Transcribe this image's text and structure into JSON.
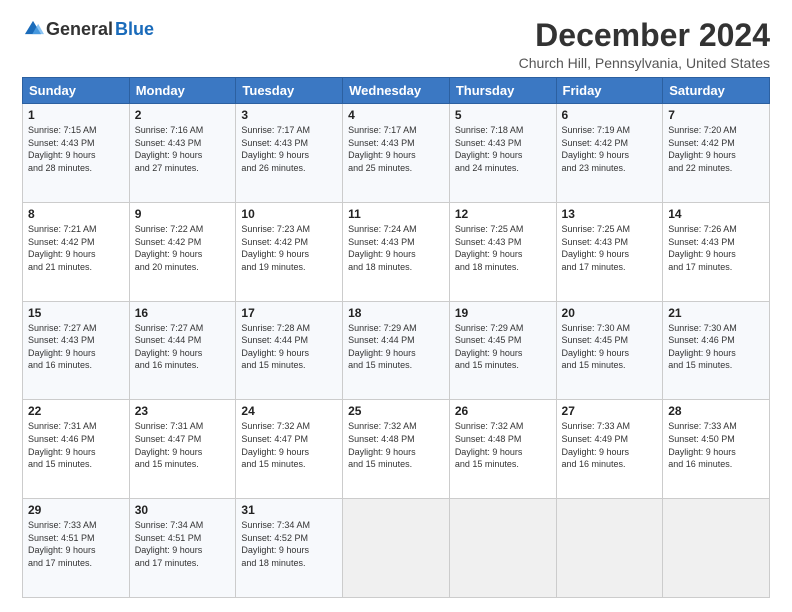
{
  "logo": {
    "general": "General",
    "blue": "Blue"
  },
  "title": "December 2024",
  "subtitle": "Church Hill, Pennsylvania, United States",
  "header_days": [
    "Sunday",
    "Monday",
    "Tuesday",
    "Wednesday",
    "Thursday",
    "Friday",
    "Saturday"
  ],
  "weeks": [
    [
      {
        "day": "1",
        "info": "Sunrise: 7:15 AM\nSunset: 4:43 PM\nDaylight: 9 hours\nand 28 minutes."
      },
      {
        "day": "2",
        "info": "Sunrise: 7:16 AM\nSunset: 4:43 PM\nDaylight: 9 hours\nand 27 minutes."
      },
      {
        "day": "3",
        "info": "Sunrise: 7:17 AM\nSunset: 4:43 PM\nDaylight: 9 hours\nand 26 minutes."
      },
      {
        "day": "4",
        "info": "Sunrise: 7:17 AM\nSunset: 4:43 PM\nDaylight: 9 hours\nand 25 minutes."
      },
      {
        "day": "5",
        "info": "Sunrise: 7:18 AM\nSunset: 4:43 PM\nDaylight: 9 hours\nand 24 minutes."
      },
      {
        "day": "6",
        "info": "Sunrise: 7:19 AM\nSunset: 4:42 PM\nDaylight: 9 hours\nand 23 minutes."
      },
      {
        "day": "7",
        "info": "Sunrise: 7:20 AM\nSunset: 4:42 PM\nDaylight: 9 hours\nand 22 minutes."
      }
    ],
    [
      {
        "day": "8",
        "info": "Sunrise: 7:21 AM\nSunset: 4:42 PM\nDaylight: 9 hours\nand 21 minutes."
      },
      {
        "day": "9",
        "info": "Sunrise: 7:22 AM\nSunset: 4:42 PM\nDaylight: 9 hours\nand 20 minutes."
      },
      {
        "day": "10",
        "info": "Sunrise: 7:23 AM\nSunset: 4:42 PM\nDaylight: 9 hours\nand 19 minutes."
      },
      {
        "day": "11",
        "info": "Sunrise: 7:24 AM\nSunset: 4:43 PM\nDaylight: 9 hours\nand 18 minutes."
      },
      {
        "day": "12",
        "info": "Sunrise: 7:25 AM\nSunset: 4:43 PM\nDaylight: 9 hours\nand 18 minutes."
      },
      {
        "day": "13",
        "info": "Sunrise: 7:25 AM\nSunset: 4:43 PM\nDaylight: 9 hours\nand 17 minutes."
      },
      {
        "day": "14",
        "info": "Sunrise: 7:26 AM\nSunset: 4:43 PM\nDaylight: 9 hours\nand 17 minutes."
      }
    ],
    [
      {
        "day": "15",
        "info": "Sunrise: 7:27 AM\nSunset: 4:43 PM\nDaylight: 9 hours\nand 16 minutes."
      },
      {
        "day": "16",
        "info": "Sunrise: 7:27 AM\nSunset: 4:44 PM\nDaylight: 9 hours\nand 16 minutes."
      },
      {
        "day": "17",
        "info": "Sunrise: 7:28 AM\nSunset: 4:44 PM\nDaylight: 9 hours\nand 15 minutes."
      },
      {
        "day": "18",
        "info": "Sunrise: 7:29 AM\nSunset: 4:44 PM\nDaylight: 9 hours\nand 15 minutes."
      },
      {
        "day": "19",
        "info": "Sunrise: 7:29 AM\nSunset: 4:45 PM\nDaylight: 9 hours\nand 15 minutes."
      },
      {
        "day": "20",
        "info": "Sunrise: 7:30 AM\nSunset: 4:45 PM\nDaylight: 9 hours\nand 15 minutes."
      },
      {
        "day": "21",
        "info": "Sunrise: 7:30 AM\nSunset: 4:46 PM\nDaylight: 9 hours\nand 15 minutes."
      }
    ],
    [
      {
        "day": "22",
        "info": "Sunrise: 7:31 AM\nSunset: 4:46 PM\nDaylight: 9 hours\nand 15 minutes."
      },
      {
        "day": "23",
        "info": "Sunrise: 7:31 AM\nSunset: 4:47 PM\nDaylight: 9 hours\nand 15 minutes."
      },
      {
        "day": "24",
        "info": "Sunrise: 7:32 AM\nSunset: 4:47 PM\nDaylight: 9 hours\nand 15 minutes."
      },
      {
        "day": "25",
        "info": "Sunrise: 7:32 AM\nSunset: 4:48 PM\nDaylight: 9 hours\nand 15 minutes."
      },
      {
        "day": "26",
        "info": "Sunrise: 7:32 AM\nSunset: 4:48 PM\nDaylight: 9 hours\nand 15 minutes."
      },
      {
        "day": "27",
        "info": "Sunrise: 7:33 AM\nSunset: 4:49 PM\nDaylight: 9 hours\nand 16 minutes."
      },
      {
        "day": "28",
        "info": "Sunrise: 7:33 AM\nSunset: 4:50 PM\nDaylight: 9 hours\nand 16 minutes."
      }
    ],
    [
      {
        "day": "29",
        "info": "Sunrise: 7:33 AM\nSunset: 4:51 PM\nDaylight: 9 hours\nand 17 minutes."
      },
      {
        "day": "30",
        "info": "Sunrise: 7:34 AM\nSunset: 4:51 PM\nDaylight: 9 hours\nand 17 minutes."
      },
      {
        "day": "31",
        "info": "Sunrise: 7:34 AM\nSunset: 4:52 PM\nDaylight: 9 hours\nand 18 minutes."
      },
      {
        "day": "",
        "info": ""
      },
      {
        "day": "",
        "info": ""
      },
      {
        "day": "",
        "info": ""
      },
      {
        "day": "",
        "info": ""
      }
    ]
  ]
}
